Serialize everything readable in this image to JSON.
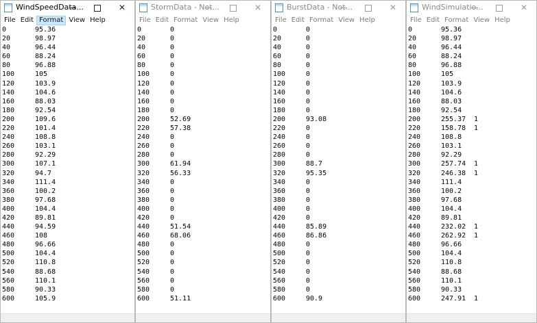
{
  "menu": [
    "File",
    "Edit",
    "Format",
    "View",
    "Help"
  ],
  "controls": {
    "close": "✕"
  },
  "windows": [
    {
      "title": "WindSpeedData...",
      "rows": [
        [
          "0",
          "95.36"
        ],
        [
          "20",
          "98.97"
        ],
        [
          "40",
          "96.44"
        ],
        [
          "60",
          "88.24"
        ],
        [
          "80",
          "96.88"
        ],
        [
          "100",
          "105"
        ],
        [
          "120",
          "103.9"
        ],
        [
          "140",
          "104.6"
        ],
        [
          "160",
          "88.03"
        ],
        [
          "180",
          "92.54"
        ],
        [
          "200",
          "109.6"
        ],
        [
          "220",
          "101.4"
        ],
        [
          "240",
          "108.8"
        ],
        [
          "260",
          "103.1"
        ],
        [
          "280",
          "92.29"
        ],
        [
          "300",
          "107.1"
        ],
        [
          "320",
          "94.7"
        ],
        [
          "340",
          "111.4"
        ],
        [
          "360",
          "100.2"
        ],
        [
          "380",
          "97.68"
        ],
        [
          "400",
          "104.4"
        ],
        [
          "420",
          "89.81"
        ],
        [
          "440",
          "94.59"
        ],
        [
          "460",
          "108"
        ],
        [
          "480",
          "96.66"
        ],
        [
          "500",
          "104.4"
        ],
        [
          "520",
          "110.8"
        ],
        [
          "540",
          "88.68"
        ],
        [
          "560",
          "110.1"
        ],
        [
          "580",
          "90.33"
        ],
        [
          "600",
          "105.9"
        ]
      ]
    },
    {
      "title": "StormData - Not...",
      "rows": [
        [
          "0",
          "0"
        ],
        [
          "20",
          "0"
        ],
        [
          "40",
          "0"
        ],
        [
          "60",
          "0"
        ],
        [
          "80",
          "0"
        ],
        [
          "100",
          "0"
        ],
        [
          "120",
          "0"
        ],
        [
          "140",
          "0"
        ],
        [
          "160",
          "0"
        ],
        [
          "180",
          "0"
        ],
        [
          "200",
          "52.69"
        ],
        [
          "220",
          "57.38"
        ],
        [
          "240",
          "0"
        ],
        [
          "260",
          "0"
        ],
        [
          "280",
          "0"
        ],
        [
          "300",
          "61.94"
        ],
        [
          "320",
          "56.33"
        ],
        [
          "340",
          "0"
        ],
        [
          "360",
          "0"
        ],
        [
          "380",
          "0"
        ],
        [
          "400",
          "0"
        ],
        [
          "420",
          "0"
        ],
        [
          "440",
          "51.54"
        ],
        [
          "460",
          "68.06"
        ],
        [
          "480",
          "0"
        ],
        [
          "500",
          "0"
        ],
        [
          "520",
          "0"
        ],
        [
          "540",
          "0"
        ],
        [
          "560",
          "0"
        ],
        [
          "580",
          "0"
        ],
        [
          "600",
          "51.11"
        ]
      ]
    },
    {
      "title": "BurstData - Not...",
      "rows": [
        [
          "0",
          "0"
        ],
        [
          "20",
          "0"
        ],
        [
          "40",
          "0"
        ],
        [
          "60",
          "0"
        ],
        [
          "80",
          "0"
        ],
        [
          "100",
          "0"
        ],
        [
          "120",
          "0"
        ],
        [
          "140",
          "0"
        ],
        [
          "160",
          "0"
        ],
        [
          "180",
          "0"
        ],
        [
          "200",
          "93.08"
        ],
        [
          "220",
          "0"
        ],
        [
          "240",
          "0"
        ],
        [
          "260",
          "0"
        ],
        [
          "280",
          "0"
        ],
        [
          "300",
          "88.7"
        ],
        [
          "320",
          "95.35"
        ],
        [
          "340",
          "0"
        ],
        [
          "360",
          "0"
        ],
        [
          "380",
          "0"
        ],
        [
          "400",
          "0"
        ],
        [
          "420",
          "0"
        ],
        [
          "440",
          "85.89"
        ],
        [
          "460",
          "86.86"
        ],
        [
          "480",
          "0"
        ],
        [
          "500",
          "0"
        ],
        [
          "520",
          "0"
        ],
        [
          "540",
          "0"
        ],
        [
          "560",
          "0"
        ],
        [
          "580",
          "0"
        ],
        [
          "600",
          "90.9"
        ]
      ]
    },
    {
      "title": "WindSimulatio...",
      "rows": [
        [
          "0",
          "95.36",
          ""
        ],
        [
          "20",
          "98.97",
          ""
        ],
        [
          "40",
          "96.44",
          ""
        ],
        [
          "60",
          "88.24",
          ""
        ],
        [
          "80",
          "96.88",
          ""
        ],
        [
          "100",
          "105",
          ""
        ],
        [
          "120",
          "103.9",
          ""
        ],
        [
          "140",
          "104.6",
          ""
        ],
        [
          "160",
          "88.03",
          ""
        ],
        [
          "180",
          "92.54",
          ""
        ],
        [
          "200",
          "255.37",
          "1"
        ],
        [
          "220",
          "158.78",
          "1"
        ],
        [
          "240",
          "108.8",
          ""
        ],
        [
          "260",
          "103.1",
          ""
        ],
        [
          "280",
          "92.29",
          ""
        ],
        [
          "300",
          "257.74",
          "1"
        ],
        [
          "320",
          "246.38",
          "1"
        ],
        [
          "340",
          "111.4",
          ""
        ],
        [
          "360",
          "100.2",
          ""
        ],
        [
          "380",
          "97.68",
          ""
        ],
        [
          "400",
          "104.4",
          ""
        ],
        [
          "420",
          "89.81",
          ""
        ],
        [
          "440",
          "232.02",
          "1"
        ],
        [
          "460",
          "262.92",
          "1"
        ],
        [
          "480",
          "96.66",
          ""
        ],
        [
          "500",
          "104.4",
          ""
        ],
        [
          "520",
          "110.8",
          ""
        ],
        [
          "540",
          "88.68",
          ""
        ],
        [
          "560",
          "110.1",
          ""
        ],
        [
          "580",
          "90.33",
          ""
        ],
        [
          "600",
          "247.91",
          "1"
        ]
      ]
    }
  ]
}
